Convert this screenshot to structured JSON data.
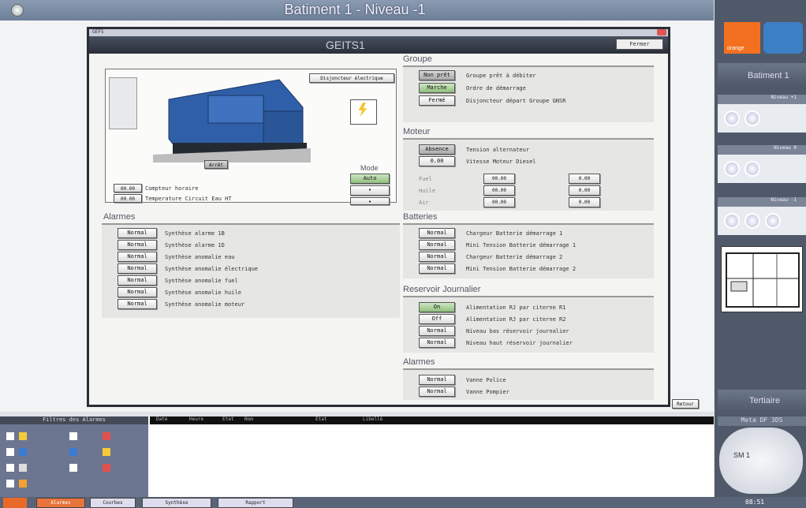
{
  "window": {
    "title": "Batiment 1 - Niveau -1"
  },
  "dialog": {
    "bar_label": "GEFS",
    "title": "GEITS1",
    "close_label": "Fermer"
  },
  "generator": {
    "breaker_label": "Disjoncteur électrique",
    "status_label": "Arrêt",
    "mode_title": "Mode",
    "mode_buttons": [
      "Auto",
      "•",
      "•"
    ],
    "counter_value": "00.00",
    "counter_label": "Compteur horaire",
    "temp_value": "00.00",
    "temp_label": "Temperature Circuit Eau HT"
  },
  "groupe": {
    "title": "Groupe",
    "rows": [
      {
        "btn": "Non prêt",
        "label": "Groupe prêt à débiter",
        "style": "gray"
      },
      {
        "btn": "Marche",
        "label": "Ordre de démarrage",
        "style": "green"
      },
      {
        "btn": "Fermé",
        "label": "Disjoncteur départ Groupe GNSR",
        "style": "plain"
      }
    ]
  },
  "moteur": {
    "title": "Moteur",
    "rows": [
      {
        "btn": "Absence",
        "label": "Tension alternateur",
        "style": "gray"
      },
      {
        "btn": "0.00",
        "label": "Vitesse Moteur Diesel",
        "style": "plain"
      }
    ],
    "grid_labels": [
      "Fuel",
      "Huile",
      "Air"
    ],
    "grid_values": [
      "00.00",
      "00.00",
      "00.00",
      "0.00",
      "0.00",
      "0.00"
    ]
  },
  "batteries": {
    "title": "Batteries",
    "rows": [
      {
        "btn": "Normal",
        "label": "Chargeur Batterie démarrage 1"
      },
      {
        "btn": "Normal",
        "label": "Mini Tension Batterie démarrage 1"
      },
      {
        "btn": "Normal",
        "label": "Chargeur Batterie démarrage 2"
      },
      {
        "btn": "Normal",
        "label": "Mini Tension Batterie démarrage 2"
      }
    ]
  },
  "reservoir": {
    "title": "Reservoir Journalier",
    "rows": [
      {
        "btn": "On",
        "label": "Alimentation RJ par citerne R1",
        "style": "green"
      },
      {
        "btn": "Off",
        "label": "Alimentation RJ par citerne R2",
        "style": "plain"
      },
      {
        "btn": "Normal",
        "label": "Niveau bas réservoir journalier",
        "style": "plain"
      },
      {
        "btn": "Normal",
        "label": "Niveau haut réservoir journalier",
        "style": "plain"
      }
    ]
  },
  "alarmes_right": {
    "title": "Alarmes",
    "rows": [
      {
        "btn": "Normal",
        "label": "Vanne Police"
      },
      {
        "btn": "Normal",
        "label": "Vanne Pompier"
      }
    ]
  },
  "alarmes_left": {
    "title": "Alarmes",
    "rows": [
      {
        "btn": "Normal",
        "label": "Synthèse alarme 1B"
      },
      {
        "btn": "Normal",
        "label": "Synthèse alarme 1D"
      },
      {
        "btn": "Normal",
        "label": "Synthèse anomalie eau"
      },
      {
        "btn": "Normal",
        "label": "Synthèse anomalie électrique"
      },
      {
        "btn": "Normal",
        "label": "Synthèse anomalie fuel"
      },
      {
        "btn": "Normal",
        "label": "Synthèse anomalie huile"
      },
      {
        "btn": "Normal",
        "label": "Synthèse anomalie moteur"
      }
    ]
  },
  "right_panel": {
    "brand": "orange",
    "building": "Batiment 1",
    "level_plus1": "Niveau +1",
    "level_0": "Niveau 0",
    "level_minus1": "Niveau -1",
    "tertiaire": "Tertiaire",
    "meta": "Meta DF 3DS",
    "meta_sub": "SM 1"
  },
  "canvas": {
    "retour": "Retour"
  },
  "bottom": {
    "left_title": "Filtres des Alarmes",
    "log_cols": [
      "Date",
      "Heure",
      "Etat",
      "Nom",
      "Etat",
      "Libellé"
    ]
  },
  "taskbar": {
    "items": [
      "Alarmes",
      "Courbes",
      "Synthèse",
      "Rapport"
    ],
    "clock": "08:51"
  }
}
